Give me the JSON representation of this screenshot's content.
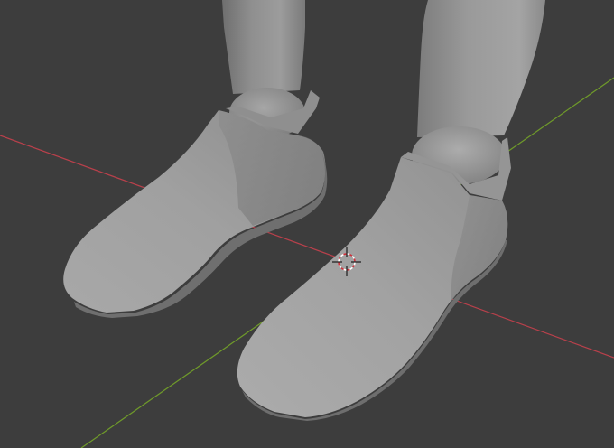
{
  "app": {
    "view": "3D Viewport",
    "background_color": "#3d3d3d"
  },
  "scene": {
    "axis_x_color": "#b8404b",
    "axis_y_color": "#6f9a2a",
    "mesh_color": "#9a9a9a",
    "objects": [
      "left-shoe",
      "right-shoe",
      "left-leg",
      "right-leg",
      "left-ankle-joint",
      "right-ankle-joint"
    ],
    "cursor": "3d-cursor"
  }
}
